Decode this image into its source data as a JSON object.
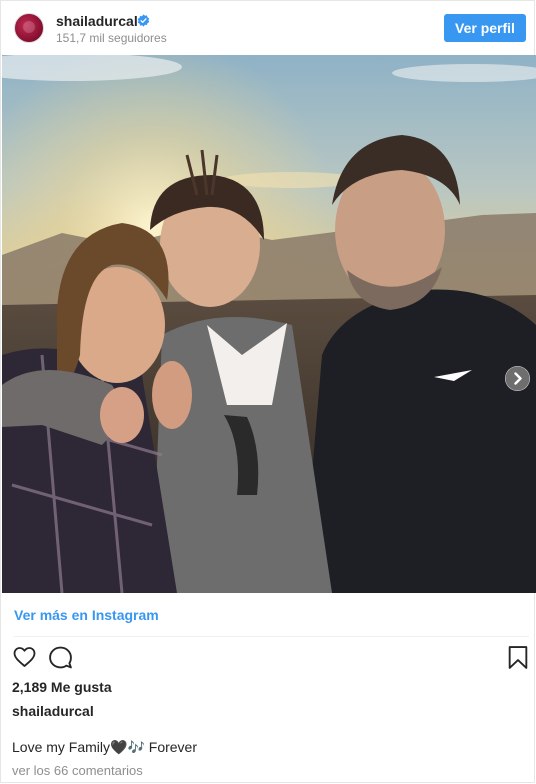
{
  "header": {
    "username": "shailadurcal",
    "followers": "151,7 mil seguidores",
    "profile_button": "Ver perfil"
  },
  "post": {
    "view_more_link": "Ver más en Instagram",
    "likes": "2,189 Me gusta",
    "owner": "shailadurcal",
    "caption": "Love my Family🖤🎶 Forever",
    "comments_link": "ver los 66 comentarios"
  },
  "icons": {
    "verified": "verified-badge-icon",
    "like": "heart-icon",
    "comment": "comment-bubble-icon",
    "save": "bookmark-icon",
    "carousel_next": "chevron-right-icon"
  },
  "colors": {
    "accent": "#3897f0",
    "text": "#262626",
    "muted": "#8e8e8e"
  }
}
